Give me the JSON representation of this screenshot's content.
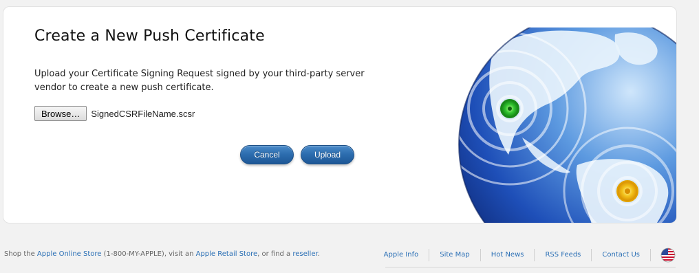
{
  "page": {
    "title": "Create a New Push Certificate",
    "description": "Upload your Certificate Signing Request signed by your third-party server vendor to create a new push certificate."
  },
  "file_input": {
    "browse_label": "Browse…",
    "file_name": "SignedCSRFileName.scsr"
  },
  "actions": {
    "cancel_label": "Cancel",
    "upload_label": "Upload"
  },
  "footer": {
    "shop_prefix": "Shop the ",
    "online_store": "Apple Online Store",
    "phone": " (1-800-MY-APPLE), visit an ",
    "retail_store": "Apple Retail Store",
    "or_find": ", or find a ",
    "reseller": "reseller",
    "period": ".",
    "links": [
      "Apple Info",
      "Site Map",
      "Hot News",
      "RSS Feeds",
      "Contact Us"
    ]
  },
  "colors": {
    "accent_blue": "#2d6eb0",
    "link_blue": "#2a6fb5",
    "marker_green": "#2fc32f",
    "marker_yellow": "#f3c21b"
  },
  "icons": {
    "globe": "globe-illustration",
    "flag": "us-flag-icon"
  }
}
